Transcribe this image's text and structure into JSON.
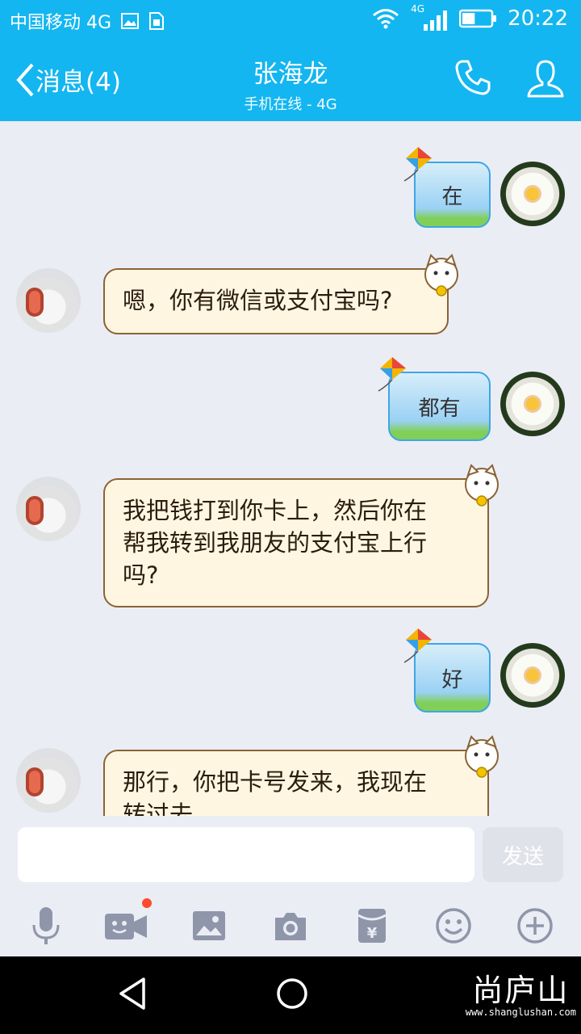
{
  "status_bar": {
    "carrier": "中国移动 4G",
    "network": "4G",
    "time": "20:22",
    "battery_level": 0.45
  },
  "header": {
    "back_label": "消息(4)",
    "title": "张海龙",
    "subtitle": "手机在线 - 4G"
  },
  "messages": [
    {
      "from": "self",
      "text": "在"
    },
    {
      "from": "peer",
      "text": "嗯，你有微信或支付宝吗?"
    },
    {
      "from": "self",
      "text": "都有"
    },
    {
      "from": "peer",
      "line1": "我把钱打到你卡上，然后你在",
      "line2": "帮我转到我朋友的支付宝上行",
      "line3": "吗?"
    },
    {
      "from": "self",
      "text": "好"
    },
    {
      "from": "peer",
      "line1": "那行，你把卡号发来，我现在",
      "line2": "转过去"
    }
  ],
  "input": {
    "value": "",
    "send_label": "发送"
  },
  "toolbar": [
    "mic-icon",
    "video-icon",
    "image-icon",
    "camera-icon",
    "red-packet-icon",
    "emoji-icon",
    "plus-icon"
  ],
  "watermark": {
    "logo": "尚庐山",
    "url": "www.shanglushan.com"
  },
  "colors": {
    "accent": "#13b6f0",
    "chat_bg": "#ebedf5",
    "notify_dot": "#ff4a2f"
  }
}
